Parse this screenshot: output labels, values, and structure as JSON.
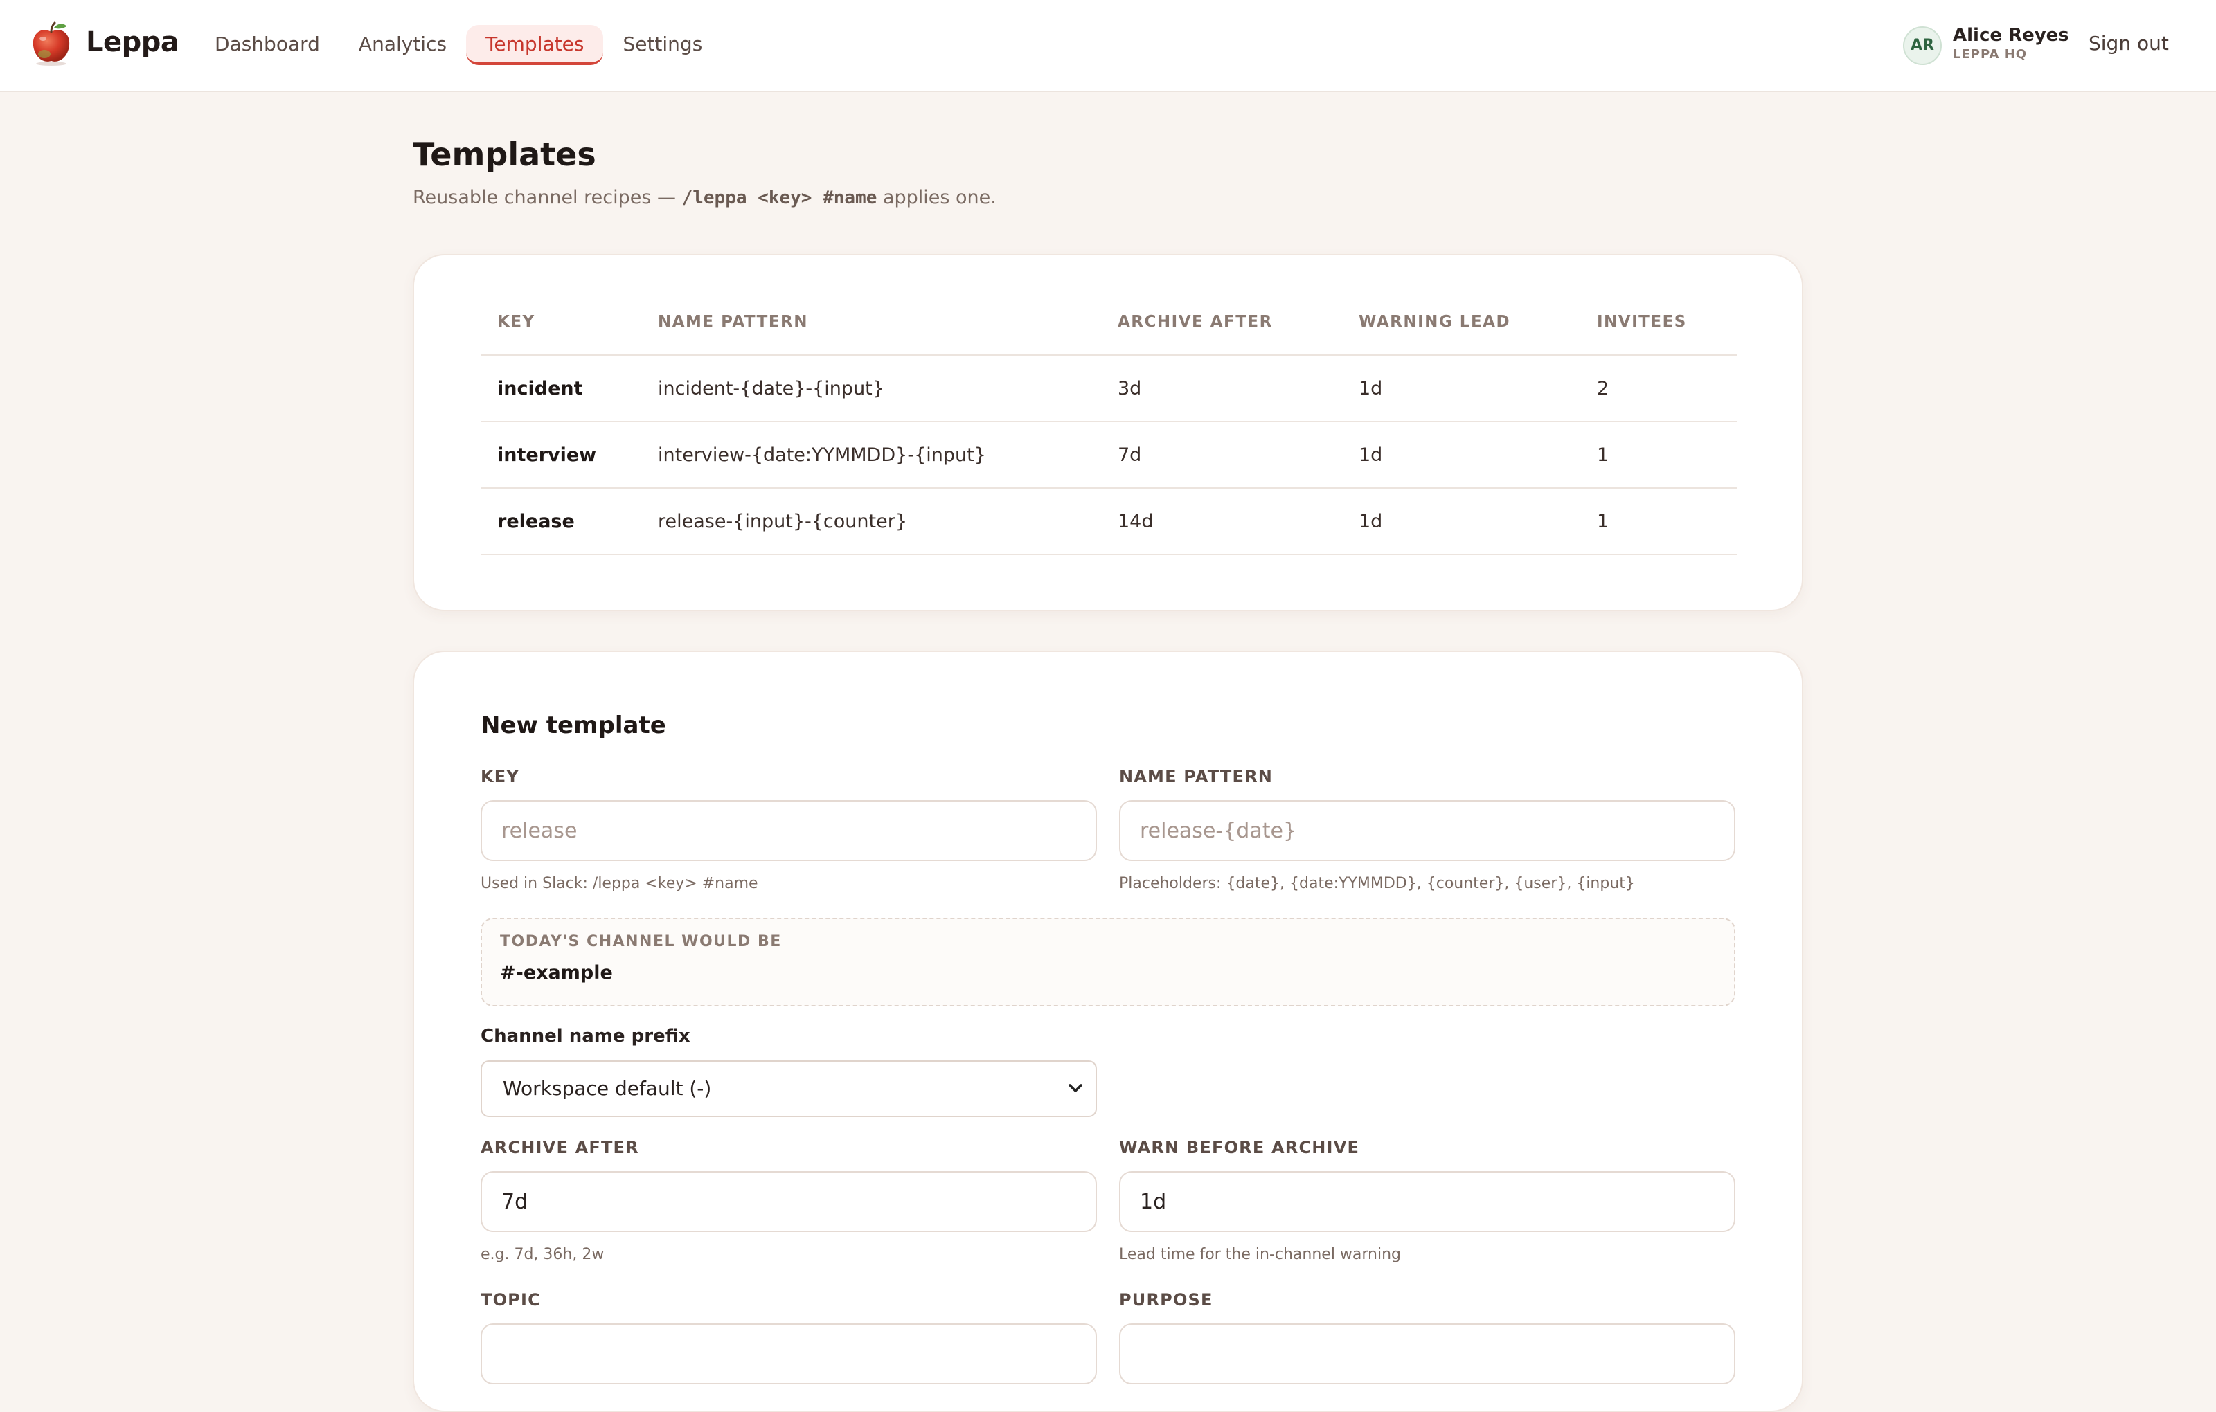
{
  "app": {
    "brand": "Leppa"
  },
  "nav": {
    "items": [
      {
        "label": "Dashboard"
      },
      {
        "label": "Analytics"
      },
      {
        "label": "Templates"
      },
      {
        "label": "Settings"
      }
    ]
  },
  "user": {
    "initials": "AR",
    "name": "Alice Reyes",
    "org": "LEPPA HQ",
    "sign_out": "Sign out"
  },
  "page": {
    "title": "Templates",
    "subtitle_prefix": "Reusable channel recipes — ",
    "subtitle_code": "/leppa <key> #name",
    "subtitle_suffix": " applies one."
  },
  "table": {
    "headers": [
      "KEY",
      "NAME PATTERN",
      "ARCHIVE AFTER",
      "WARNING LEAD",
      "INVITEES"
    ],
    "rows": [
      [
        "incident",
        "incident-{date}-{input}",
        "3d",
        "1d",
        "2"
      ],
      [
        "interview",
        "interview-{date:YYMMDD}-{input}",
        "7d",
        "1d",
        "1"
      ],
      [
        "release",
        "release-{input}-{counter}",
        "14d",
        "1d",
        "1"
      ]
    ]
  },
  "form": {
    "title": "New template",
    "key": {
      "label": "KEY",
      "placeholder": "release",
      "hint": "Used in Slack: /leppa <key> #name"
    },
    "name_pattern": {
      "label": "NAME PATTERN",
      "placeholder": "release-{date}",
      "hint": "Placeholders: {date}, {date:YYMMDD}, {counter}, {user}, {input}"
    },
    "preview": {
      "label": "TODAY'S CHANNEL WOULD BE",
      "value": "#-example"
    },
    "prefix": {
      "label": "Channel name prefix",
      "selected": "Workspace default (-)"
    },
    "archive_after": {
      "label": "ARCHIVE AFTER",
      "value": "7d",
      "hint": "e.g. 7d, 36h, 2w"
    },
    "warn_before": {
      "label": "WARN BEFORE ARCHIVE",
      "value": "1d",
      "hint": "Lead time for the in-channel warning"
    },
    "topic": {
      "label": "TOPIC",
      "value": ""
    },
    "purpose": {
      "label": "PURPOSE",
      "value": ""
    }
  },
  "colors": {
    "accent": "#d3463a",
    "background": "#f9f4f0"
  }
}
